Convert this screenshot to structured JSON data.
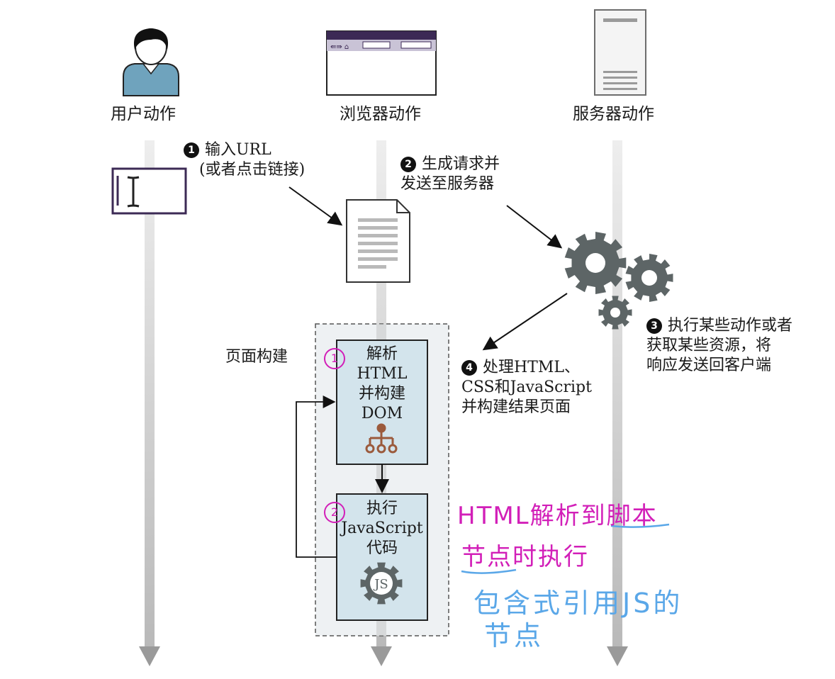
{
  "columns": {
    "user": "用户动作",
    "browser": "浏览器动作",
    "server": "服务器动作"
  },
  "steps": [
    {
      "num": "1",
      "lines": [
        "输入URL",
        "(或者点击链接)"
      ]
    },
    {
      "num": "2",
      "lines": [
        "生成请求并",
        "发送至服务器"
      ]
    },
    {
      "num": "3",
      "lines": [
        "执行某些动作或者",
        "获取某些资源，将",
        "响应发送回客户端"
      ]
    },
    {
      "num": "4",
      "lines": [
        "处理HTML、",
        "CSS和JavaScript",
        "并构建结果页面"
      ]
    }
  ],
  "page_build": {
    "label": "页面构建",
    "box1": [
      "解析",
      "HTML",
      "并构建",
      "DOM"
    ],
    "box2": [
      "执行",
      "JavaScript",
      "代码"
    ],
    "js_icon": "JS"
  },
  "annotations": {
    "circle1": "1",
    "circle2": "2",
    "pink_line1": "HTML解析到脚本",
    "pink_line2": "节点时执行",
    "blue_line1": "包含式引用JS的",
    "blue_line2": "节点"
  },
  "colors": {
    "lane": "#cfcfcf",
    "box_fill": "#d3e4ec",
    "purple": "#3c2a55",
    "gear": "#5d6566",
    "dom_icon": "#9b5a3c",
    "annotation_pink": "#d21fb8",
    "annotation_blue": "#5aa7e8"
  },
  "icons": [
    "user-icon",
    "browser-window-icon",
    "server-icon",
    "text-cursor-icon",
    "document-icon",
    "gears-icon",
    "dom-tree-icon",
    "js-gear-icon"
  ]
}
